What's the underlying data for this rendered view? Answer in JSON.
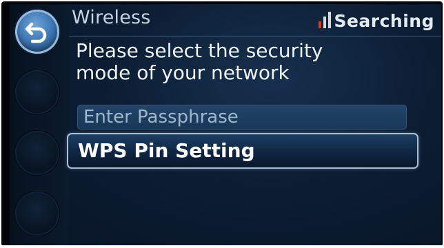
{
  "header": {
    "title": "Wireless",
    "status": "Searching",
    "signal_colors": [
      "#d23a2a",
      "#d9d9d9",
      "#d9d9d9"
    ]
  },
  "left_rail": {
    "back_icon": "back-arrow-icon"
  },
  "prompt": {
    "text_line1": "Please select the security",
    "text_line2": "mode of your network"
  },
  "options": [
    {
      "label": "Enter Passphrase"
    },
    {
      "label": "WPS Pin Setting"
    }
  ],
  "colors": {
    "screen_bg": "#0c1d33",
    "accent": "#3f78b5",
    "selected_border": "#a9c1d8"
  }
}
